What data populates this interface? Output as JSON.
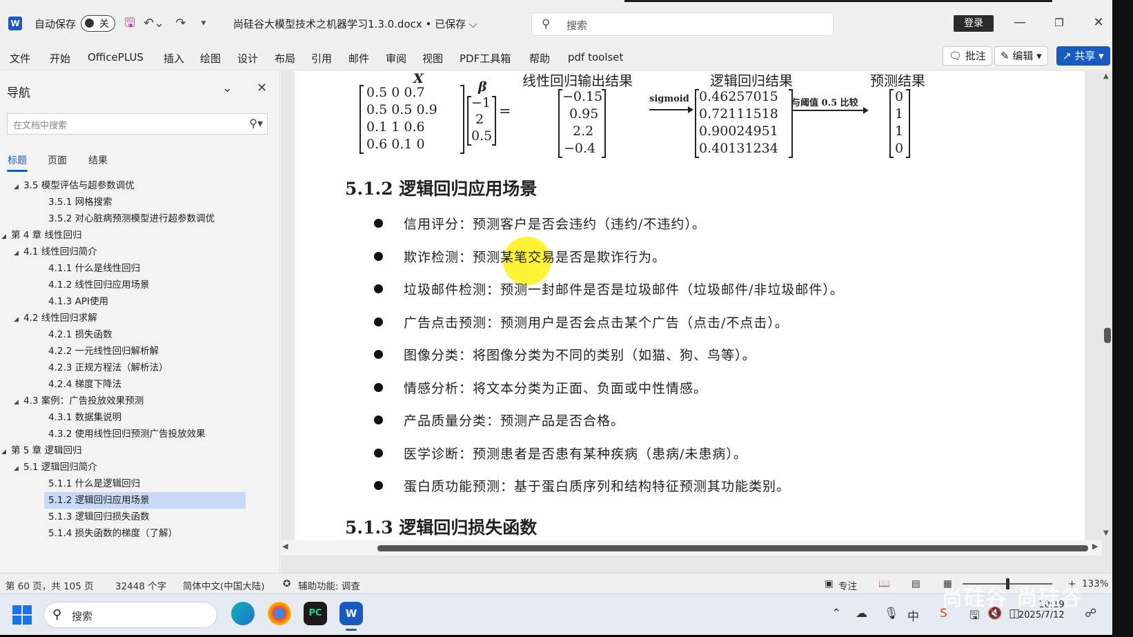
{
  "titlebar": {
    "app_icon": "W",
    "autosave_label": "自动保存",
    "autosave_toggle": "关",
    "doc_title": "尚硅谷大模型技术之机器学习1.3.0.docx • 已保存 ⌵",
    "search_placeholder": "搜索",
    "login_label": "登录"
  },
  "menu": [
    "文件",
    "开始",
    "OfficePLUS",
    "插入",
    "绘图",
    "设计",
    "布局",
    "引用",
    "邮件",
    "审阅",
    "视图",
    "PDF工具箱",
    "帮助",
    "pdf toolset"
  ],
  "ribbon_buttons": {
    "comment": "批注",
    "edit": "编辑",
    "share": "共享"
  },
  "nav": {
    "title": "导航",
    "search_placeholder": "在文档中搜索",
    "tabs": [
      "标题",
      "页面",
      "结果"
    ],
    "items": [
      {
        "text": "3.5 模型评估与超参数调优",
        "level": 2,
        "expanded": true
      },
      {
        "text": "3.5.1 网格搜索",
        "level": 3
      },
      {
        "text": "3.5.2 对心脏病预测模型进行超参数调优",
        "level": 3
      },
      {
        "text": "第 4 章 线性回归",
        "level": 1,
        "expanded": true
      },
      {
        "text": "4.1 线性回归简介",
        "level": 2,
        "expanded": true
      },
      {
        "text": "4.1.1 什么是线性回归",
        "level": 3
      },
      {
        "text": "4.1.2 线性回归应用场景",
        "level": 3
      },
      {
        "text": "4.1.3 API使用",
        "level": 3
      },
      {
        "text": "4.2 线性回归求解",
        "level": 2,
        "expanded": true
      },
      {
        "text": "4.2.1 损失函数",
        "level": 3
      },
      {
        "text": "4.2.2 一元线性回归解析解",
        "level": 3
      },
      {
        "text": "4.2.3 正规方程法（解析法）",
        "level": 3
      },
      {
        "text": "4.2.4 梯度下降法",
        "level": 3
      },
      {
        "text": "4.3 案例：广告投放效果预测",
        "level": 2,
        "expanded": true
      },
      {
        "text": "4.3.1 数据集说明",
        "level": 3
      },
      {
        "text": "4.3.2 使用线性回归预测广告投放效果",
        "level": 3
      },
      {
        "text": "第 5 章 逻辑回归",
        "level": 1,
        "expanded": true
      },
      {
        "text": "5.1 逻辑回归简介",
        "level": 2,
        "expanded": true
      },
      {
        "text": "5.1.1 什么是逻辑回归",
        "level": 3
      },
      {
        "text": "5.1.2 逻辑回归应用场景",
        "level": 3,
        "selected": true
      },
      {
        "text": "5.1.3 逻辑回归损失函数",
        "level": 3
      },
      {
        "text": "5.1.4 损失函数的梯度（了解）",
        "level": 3
      }
    ]
  },
  "document": {
    "figure": {
      "x_label": "X",
      "beta_label": "β",
      "matrix_x": [
        "0.5    0    0.7",
        "0.5  0.5  0.9",
        "0.1    1    0.6",
        "0.6  0.1    0"
      ],
      "beta": [
        "−1",
        "2",
        "0.5"
      ],
      "equals": "=",
      "linear_title": "线性回归输出结果",
      "linear": [
        "−0.15",
        "0.95",
        "2.2",
        "−0.4"
      ],
      "sigmoid_label": "sigmoid",
      "logistic_title": "逻辑回归结果",
      "logistic": [
        "0.46257015",
        "0.72111518",
        "0.90024951",
        "0.40131234"
      ],
      "threshold_label": "与阈值 0.5 比较",
      "pred_title": "预测结果",
      "pred": [
        "0",
        "1",
        "1",
        "0"
      ]
    },
    "heading_512": "5.1.2  逻辑回归应用场景",
    "bullets": [
      "信用评分：预测客户是否会违约（违约/不违约）。",
      "欺诈检测：预测某笔交易是否是欺诈行为。",
      "垃圾邮件检测：预测一封邮件是否是垃圾邮件（垃圾邮件/非垃圾邮件）。",
      "广告点击预测：预测用户是否会点击某个广告（点击/不点击）。",
      "图像分类：将图像分类为不同的类别（如猫、狗、鸟等）。",
      "情感分析：将文本分类为正面、负面或中性情感。",
      "产品质量分类：预测产品是否合格。",
      "医学诊断：预测患者是否患有某种疾病（患病/未患病）。",
      "蛋白质功能预测：基于蛋白质序列和结构特征预测其功能类别。"
    ],
    "heading_513": "5.1.3  逻辑回归损失函数"
  },
  "status": {
    "page": "第 60 页，共 105 页",
    "words": "32448 个字",
    "language": "简体中文(中国大陆)",
    "accessibility": "辅助功能: 调查",
    "focus": "专注",
    "zoom_minus": "−",
    "zoom_plus": "+",
    "zoom": "133%"
  },
  "taskbar": {
    "search_placeholder": "搜索",
    "time": "10:19",
    "date": "2025/7/12"
  },
  "watermark": "尚硅谷 尚硅谷",
  "colors": {
    "accent": "#185abd",
    "selected_nav": "#c9d8f5",
    "cursor_highlight": "#fff000"
  }
}
